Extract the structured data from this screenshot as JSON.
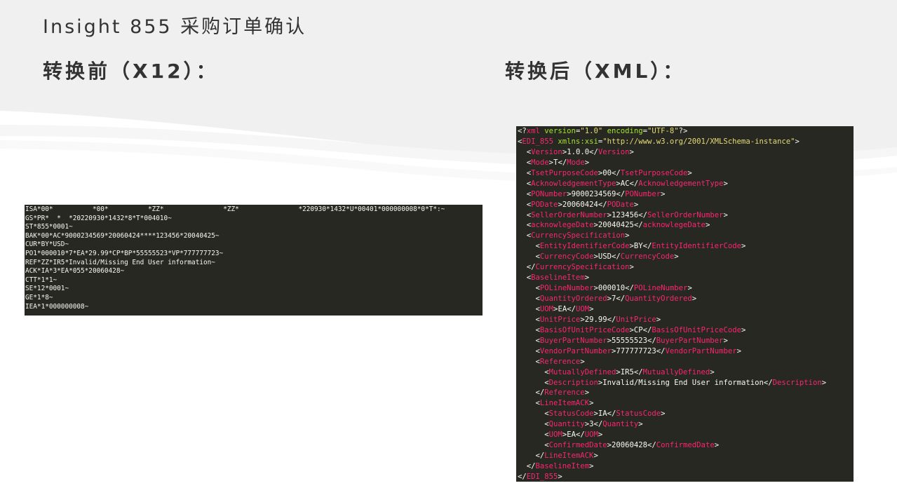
{
  "slide": {
    "title": "Insight 855 采购订单确认",
    "before_heading": "转换前（X12）：",
    "after_heading": "转换后（XML）："
  },
  "x12_lines": [
    "ISA*00*          *00*          *ZZ*               *ZZ*               *220930*1432*U*00401*000000008*0*T*:~",
    "GS*PR*  *  *20220930*1432*8*T*004010~",
    "ST*855*0001~",
    "BAK*00*AC*9000234569*20060424****123456*20040425~",
    "CUR*BY*USD~",
    "PO1*000010*7*EA*29.99*CP*BP*55555523*VP*777777723~",
    "REF*ZZ*IR5*Invalid/Missing End User information~",
    "ACK*IA*3*EA*055*20060428~",
    "CTT*1*1~",
    "SE*12*0001~",
    "GE*1*8~",
    "IEA*1*000000008~"
  ],
  "xml_lines": [
    {
      "kind": "decl",
      "version": "1.0",
      "encoding": "UTF-8"
    },
    {
      "kind": "open_attr",
      "indent": 0,
      "tag": "EDI_855",
      "attr": "xmlns:xsi",
      "value": "http://www.w3.org/2001/XMLSchema-instance"
    },
    {
      "kind": "leaf",
      "indent": 1,
      "tag": "Version",
      "text": "1.0.0"
    },
    {
      "kind": "leaf",
      "indent": 1,
      "tag": "Mode",
      "text": "T"
    },
    {
      "kind": "leaf",
      "indent": 1,
      "tag": "TsetPurposeCode",
      "text": "00"
    },
    {
      "kind": "leaf",
      "indent": 1,
      "tag": "AcknowledgementType",
      "text": "AC"
    },
    {
      "kind": "leaf",
      "indent": 1,
      "tag": "PONumber",
      "text": "9000234569"
    },
    {
      "kind": "leaf",
      "indent": 1,
      "tag": "PODate",
      "text": "20060424"
    },
    {
      "kind": "leaf",
      "indent": 1,
      "tag": "SellerOrderNumber",
      "text": "123456"
    },
    {
      "kind": "leaf",
      "indent": 1,
      "tag": "acknowlegeDate",
      "text": "20040425"
    },
    {
      "kind": "open",
      "indent": 1,
      "tag": "CurrencySpecification"
    },
    {
      "kind": "leaf",
      "indent": 2,
      "tag": "EntityIdentifierCode",
      "text": "BY"
    },
    {
      "kind": "leaf",
      "indent": 2,
      "tag": "CurrencyCode",
      "text": "USD"
    },
    {
      "kind": "close",
      "indent": 1,
      "tag": "CurrencySpecification"
    },
    {
      "kind": "open",
      "indent": 1,
      "tag": "BaselineItem"
    },
    {
      "kind": "leaf",
      "indent": 2,
      "tag": "POLineNumber",
      "text": "000010"
    },
    {
      "kind": "leaf",
      "indent": 2,
      "tag": "QuantityOrdered",
      "text": "7"
    },
    {
      "kind": "leaf",
      "indent": 2,
      "tag": "UOM",
      "text": "EA"
    },
    {
      "kind": "leaf",
      "indent": 2,
      "tag": "UnitPrice",
      "text": "29.99"
    },
    {
      "kind": "leaf",
      "indent": 2,
      "tag": "BasisOfUnitPriceCode",
      "text": "CP"
    },
    {
      "kind": "leaf",
      "indent": 2,
      "tag": "BuyerPartNumber",
      "text": "55555523"
    },
    {
      "kind": "leaf",
      "indent": 2,
      "tag": "VendorPartNumber",
      "text": "777777723"
    },
    {
      "kind": "open",
      "indent": 2,
      "tag": "Reference"
    },
    {
      "kind": "leaf",
      "indent": 3,
      "tag": "MutuallyDefined",
      "text": "IR5"
    },
    {
      "kind": "leaf",
      "indent": 3,
      "tag": "Description",
      "text": "Invalid/Missing End User information"
    },
    {
      "kind": "close",
      "indent": 2,
      "tag": "Reference"
    },
    {
      "kind": "open",
      "indent": 2,
      "tag": "LineItemACK"
    },
    {
      "kind": "leaf",
      "indent": 3,
      "tag": "StatusCode",
      "text": "IA"
    },
    {
      "kind": "leaf",
      "indent": 3,
      "tag": "Quantity",
      "text": "3"
    },
    {
      "kind": "leaf",
      "indent": 3,
      "tag": "UOM",
      "text": "EA"
    },
    {
      "kind": "leaf",
      "indent": 3,
      "tag": "ConfirmedDate",
      "text": "20060428"
    },
    {
      "kind": "close",
      "indent": 2,
      "tag": "LineItemACK"
    },
    {
      "kind": "close",
      "indent": 1,
      "tag": "BaselineItem"
    },
    {
      "kind": "close",
      "indent": 0,
      "tag": "EDI_855"
    }
  ],
  "colors": {
    "editor_bg": "#272822",
    "tag": "#f92672",
    "attr": "#a6e22e",
    "string": "#e6db74",
    "text": "#f8f8f2",
    "heading": "#333333"
  }
}
